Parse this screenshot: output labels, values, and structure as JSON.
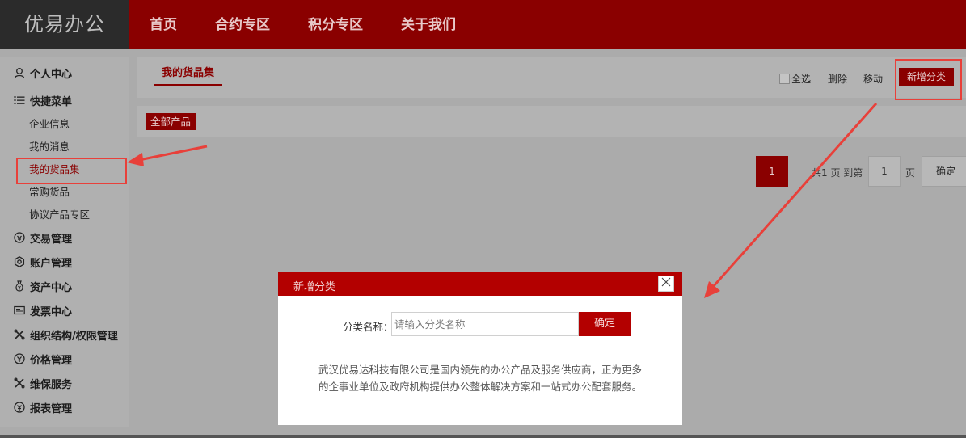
{
  "header": {
    "logo": "优易办公",
    "nav": [
      "首页",
      "合约专区",
      "积分专区",
      "关于我们"
    ]
  },
  "sidebar": {
    "groups": [
      {
        "label": "个人中心",
        "icon": "user-icon"
      },
      {
        "label": "快捷菜单",
        "icon": "list-icon"
      },
      {
        "label": "交易管理",
        "icon": "trade-icon"
      },
      {
        "label": "账户管理",
        "icon": "gear-icon"
      },
      {
        "label": "资产中心",
        "icon": "money-bag-icon"
      },
      {
        "label": "发票中心",
        "icon": "invoice-icon"
      },
      {
        "label": "组织结构/权限管理",
        "icon": "tools-icon"
      },
      {
        "label": "价格管理",
        "icon": "price-icon"
      },
      {
        "label": "维保服务",
        "icon": "wrench-icon"
      },
      {
        "label": "报表管理",
        "icon": "report-icon"
      }
    ],
    "submenu": [
      "企业信息",
      "我的消息",
      "我的货品集",
      "常购货品",
      "协议产品专区"
    ],
    "active_submenu": "我的货品集"
  },
  "content": {
    "tab": "我的货品集",
    "select_all": "全选",
    "delete": "删除",
    "move": "移动",
    "add_category": "新增分类",
    "category_tag": "全部产品"
  },
  "pagination": {
    "current": "1",
    "total_text": "共1 页 到第",
    "page_input": "1",
    "page_suffix": "页",
    "confirm": "确定"
  },
  "modal": {
    "title": "新增分类",
    "field_label": "分类名称：",
    "placeholder": "请输入分类名称",
    "ok": "确定",
    "description": "武汉优易达科技有限公司是国内领先的办公产品及服务供应商，正为更多的企事业单位及政府机构提供办公整体解决方案和一站式办公配套服务。"
  },
  "colors": {
    "brand": "#8a0000",
    "modal_header": "#b30000",
    "annotation": "#e8403a"
  }
}
